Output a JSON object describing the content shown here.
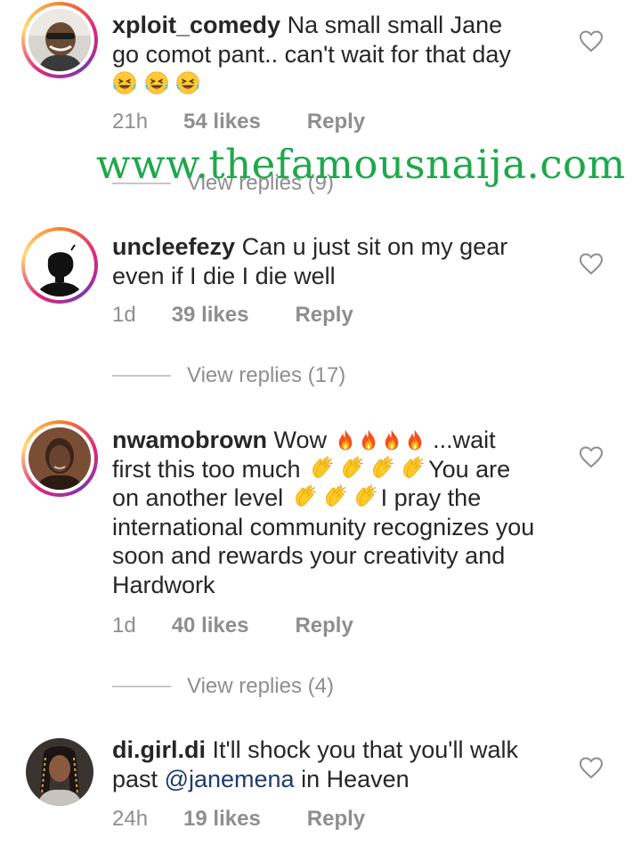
{
  "comments": [
    {
      "username": "xploit_comedy",
      "text_line1": "Na small small Jane",
      "text_line2": "go comot pant.. can't wait for that day",
      "emoji": [
        "rolling-laugh",
        "rolling-laugh",
        "rolling-laugh"
      ],
      "time": "21h",
      "likes": "54 likes",
      "reply": "Reply",
      "view_replies": "View replies (9)",
      "has_story_ring": true
    },
    {
      "username": "uncleefezy",
      "text_line1": "Can u just sit on my gear",
      "text_line2": "even if I die I die well",
      "time": "1d",
      "likes": "39 likes",
      "reply": "Reply",
      "view_replies": "View replies (17)",
      "has_story_ring": true
    },
    {
      "username": "nwamobrown",
      "seg1": "Wow",
      "seg2": "...wait",
      "seg3": "first this too much",
      "seg4": "You are",
      "seg5": "on another level",
      "seg6": "I pray the",
      "seg7": "international community recognizes you",
      "seg8": "soon and rewards your creativity and",
      "seg9": "Hardwork",
      "emoji_fire": [
        "fire",
        "fire",
        "fire",
        "fire"
      ],
      "emoji_clap_a": [
        "clapping-hands",
        "clapping-hands",
        "clapping-hands",
        "clapping-hands"
      ],
      "emoji_clap_b": [
        "clapping-hands",
        "clapping-hands",
        "clapping-hands"
      ],
      "time": "1d",
      "likes": "40 likes",
      "reply": "Reply",
      "view_replies": "View replies (4)",
      "has_story_ring": true
    },
    {
      "username": "di.girl.di",
      "text_part1": "It'll shock you that you'll walk",
      "text_part2": "past",
      "mention": "@janemena",
      "text_part3": "in Heaven",
      "time": "24h",
      "likes": "19 likes",
      "reply": "Reply",
      "has_story_ring": false
    }
  ],
  "watermark": "www.thefamousnaija.com",
  "colors": {
    "text": "#262626",
    "muted": "#8e8e8e",
    "mention": "#1e3a6e",
    "watermark": "#1ea84a"
  },
  "icons": {
    "like": "heart-outline-icon"
  }
}
